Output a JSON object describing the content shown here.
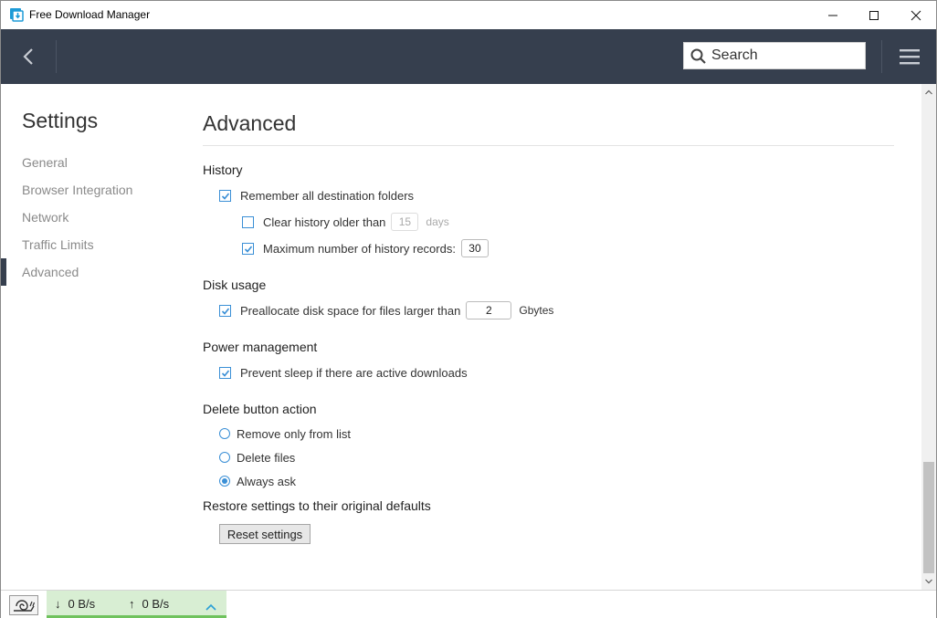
{
  "window": {
    "title": "Free Download Manager"
  },
  "header": {
    "search_placeholder": "Search"
  },
  "sidebar": {
    "title": "Settings",
    "items": [
      {
        "label": "General"
      },
      {
        "label": "Browser Integration"
      },
      {
        "label": "Network"
      },
      {
        "label": "Traffic Limits"
      },
      {
        "label": "Advanced",
        "active": true
      }
    ]
  },
  "content": {
    "heading": "Advanced",
    "history": {
      "title": "History",
      "remember_label": "Remember all destination folders",
      "remember_checked": true,
      "clear_label": "Clear history older than",
      "clear_checked": false,
      "clear_value": "15",
      "clear_unit": "days",
      "max_label": "Maximum number of history records:",
      "max_checked": true,
      "max_value": "30"
    },
    "disk": {
      "title": "Disk usage",
      "prealloc_label": "Preallocate disk space for files larger than",
      "prealloc_checked": true,
      "prealloc_value": "2",
      "prealloc_unit": "Gbytes"
    },
    "power": {
      "title": "Power management",
      "prevent_label": "Prevent sleep if there are active downloads",
      "prevent_checked": true
    },
    "delete": {
      "title": "Delete button action",
      "options": [
        {
          "label": "Remove only from list",
          "selected": false
        },
        {
          "label": "Delete files",
          "selected": false
        },
        {
          "label": "Always ask",
          "selected": true
        }
      ]
    },
    "restore": {
      "title": "Restore settings to their original defaults",
      "button_label": "Reset settings"
    }
  },
  "statusbar": {
    "download_speed": "0 B/s",
    "upload_speed": "0 B/s"
  },
  "colors": {
    "header_bg": "#363f4e",
    "accent": "#3a8fd6",
    "speed_panel_bg": "#d8eed3",
    "speed_panel_border": "#6fc25d"
  }
}
